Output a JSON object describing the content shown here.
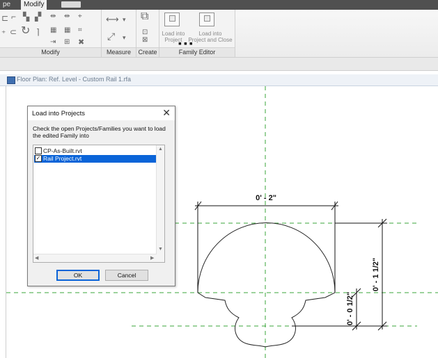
{
  "ribbon": {
    "tabs": [
      {
        "label": "pe",
        "active": false
      },
      {
        "label": "Modify",
        "active": true
      }
    ],
    "panels": {
      "modify": "Modify",
      "measure": "Measure",
      "create": "Create",
      "family_editor": "Family Editor"
    },
    "buttons": {
      "load_into_project_line1": "Load into",
      "load_into_project_line2": "Project",
      "load_into_project_close_line1": "Load into",
      "load_into_project_close_line2": "Project and Close"
    }
  },
  "view": {
    "title": "Floor Plan: Ref. Level - Custom Rail 1.rfa"
  },
  "dimensions": {
    "width": "0' - 2\"",
    "height": "0' - 1 1/2\"",
    "small": "0' - 0 1/2\""
  },
  "dialog": {
    "title": "Load into Projects",
    "close_glyph": "✕",
    "instruction": "Check the open Projects/Families you want to load the edited Family into",
    "items": [
      {
        "label": "CP-As-Built.rvt",
        "checked": false,
        "selected": false
      },
      {
        "label": "Rail Project.rvt",
        "checked": true,
        "selected": true
      }
    ],
    "ok_label": "OK",
    "cancel_label": "Cancel"
  },
  "colors": {
    "selection": "#0a64d8",
    "reference_plane": "#3aa63a"
  }
}
